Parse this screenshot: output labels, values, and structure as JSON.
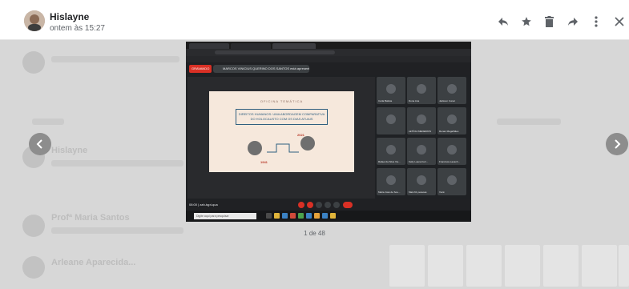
{
  "message": {
    "sender": "Hislayne",
    "date": "ontem às 15:27"
  },
  "actions": [
    {
      "name": "reply-icon",
      "label": "reply"
    },
    {
      "name": "star-icon",
      "label": "star"
    },
    {
      "name": "delete-icon",
      "label": "delete"
    },
    {
      "name": "forward-icon",
      "label": "forward"
    },
    {
      "name": "more-icon",
      "label": "more"
    },
    {
      "name": "close-icon",
      "label": "close"
    }
  ],
  "viewer": {
    "counter": "1 de 48",
    "prev_icon": "chevron-left-icon",
    "next_icon": "chevron-right-icon"
  },
  "screenshot_content": {
    "recording_label": "GRAVANDO",
    "presenting_text": "MARCOS VINICIUS QUERINO DOS SANTOS está apresentando",
    "slide_kicker": "OFICINA TEMÁTICA",
    "slide_title": "DIREITOS HUMANOS: UMA ABORDAGEM COMPARATIVA DO HOLOCAUSTO COM OS DIAS ATUAIS",
    "year_start": "1941",
    "year_end": "2021",
    "meeting_code": "08:00 | zah-tqpt-qua",
    "taskbar_search": "Digite aqui para pesquisar",
    "participants": [
      "Carla Batista",
      "Dona Ana",
      "Jackson Cunar",
      "",
      "LETÍCIA MEDEIROS",
      "Renan Magalhães",
      "Rafael da Silva Vie...",
      "Kelly Luana Ferr...",
      "Francisca Lavanh...",
      "Maria José de Sou...",
      "Mais 61 pessoas",
      "Você"
    ]
  },
  "background": {
    "row_senders": [
      "Hislayne",
      "Profª Maria Santos",
      "Arleane Aparecida..."
    ]
  },
  "colors": {
    "overlay": "#d7d7d7",
    "record_red": "#d93025",
    "slide_bg": "#f6e8dc",
    "slide_title": "#2f5f7f"
  }
}
